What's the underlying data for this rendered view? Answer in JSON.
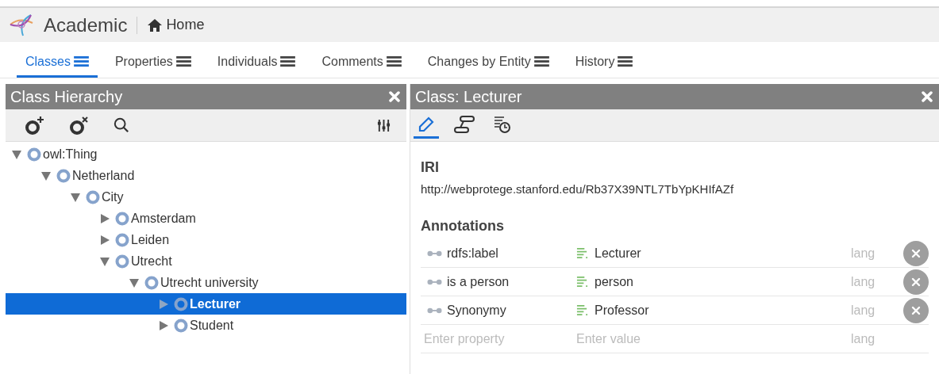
{
  "app": {
    "title": "Academic",
    "home": "Home"
  },
  "tabs": [
    {
      "label": "Classes",
      "selected": true
    },
    {
      "label": "Properties",
      "selected": false
    },
    {
      "label": "Individuals",
      "selected": false
    },
    {
      "label": "Comments",
      "selected": false
    },
    {
      "label": "Changes by Entity",
      "selected": false
    },
    {
      "label": "History",
      "selected": false
    }
  ],
  "left_panel": {
    "title": "Class Hierarchy",
    "tree": [
      {
        "label": "owl:Thing",
        "expanded": true,
        "selected": false,
        "children": [
          {
            "label": "Netherland",
            "expanded": true,
            "selected": false,
            "children": [
              {
                "label": "City",
                "expanded": true,
                "selected": false,
                "children": [
                  {
                    "label": "Amsterdam",
                    "expanded": false,
                    "selected": false
                  },
                  {
                    "label": "Leiden",
                    "expanded": false,
                    "selected": false
                  },
                  {
                    "label": "Utrecht",
                    "expanded": true,
                    "selected": false,
                    "children": [
                      {
                        "label": "Utrecht university",
                        "expanded": true,
                        "selected": false,
                        "children": [
                          {
                            "label": "Lecturer",
                            "expanded": false,
                            "selected": true
                          },
                          {
                            "label": "Student",
                            "expanded": false,
                            "selected": false
                          }
                        ]
                      }
                    ]
                  }
                ]
              }
            ]
          }
        ]
      }
    ]
  },
  "right_panel": {
    "title": "Class: Lecturer",
    "view_tabs": [
      {
        "kind": "edit",
        "selected": true
      },
      {
        "kind": "graph",
        "selected": false
      },
      {
        "kind": "history",
        "selected": false
      }
    ],
    "iri": {
      "label": "IRI",
      "value": "http://webprotege.stanford.edu/Rb37X39NTL7TbYpKHIfAZf"
    },
    "annotations": {
      "title": "Annotations",
      "rows": [
        {
          "property": "rdfs:label",
          "value": "Lecturer",
          "lang_placeholder": "lang"
        },
        {
          "property": "is a person",
          "value": "person",
          "lang_placeholder": "lang"
        },
        {
          "property": "Synonymy",
          "value": "Professor",
          "lang_placeholder": "lang"
        }
      ],
      "new_row": {
        "property_placeholder": "Enter property",
        "value_placeholder": "Enter value",
        "lang_placeholder": "lang"
      }
    }
  }
}
